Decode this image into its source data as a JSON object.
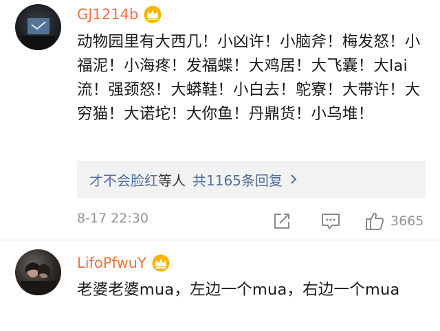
{
  "comments": [
    {
      "username": "GJ1214b",
      "badge": "crown-icon",
      "text": "动物园里有大西几！小凶许！小脑斧！梅发怒！小福泥！小海疼！发福蝶！大鸡居！大飞囊！大lai流！强颈怒！大蟒鞋！小白去！鸵寮！大带许！大穷猫！大诺坨！大你鱼！丹鼎货！小乌堆！",
      "replies": {
        "who": "才不会脸红",
        "mid": "等人",
        "count": "共1165条回复"
      },
      "time": "8-17 22:30",
      "likes": "3665"
    },
    {
      "username": "LifoPfwuY",
      "badge": "crown-icon",
      "text": "老婆老婆mua，左边一个mua，右边一个mua"
    }
  ],
  "colors": {
    "username": "#eb7340",
    "link": "#4e6e9e",
    "muted": "#939393",
    "reply_bg": "#f2f2f2"
  }
}
